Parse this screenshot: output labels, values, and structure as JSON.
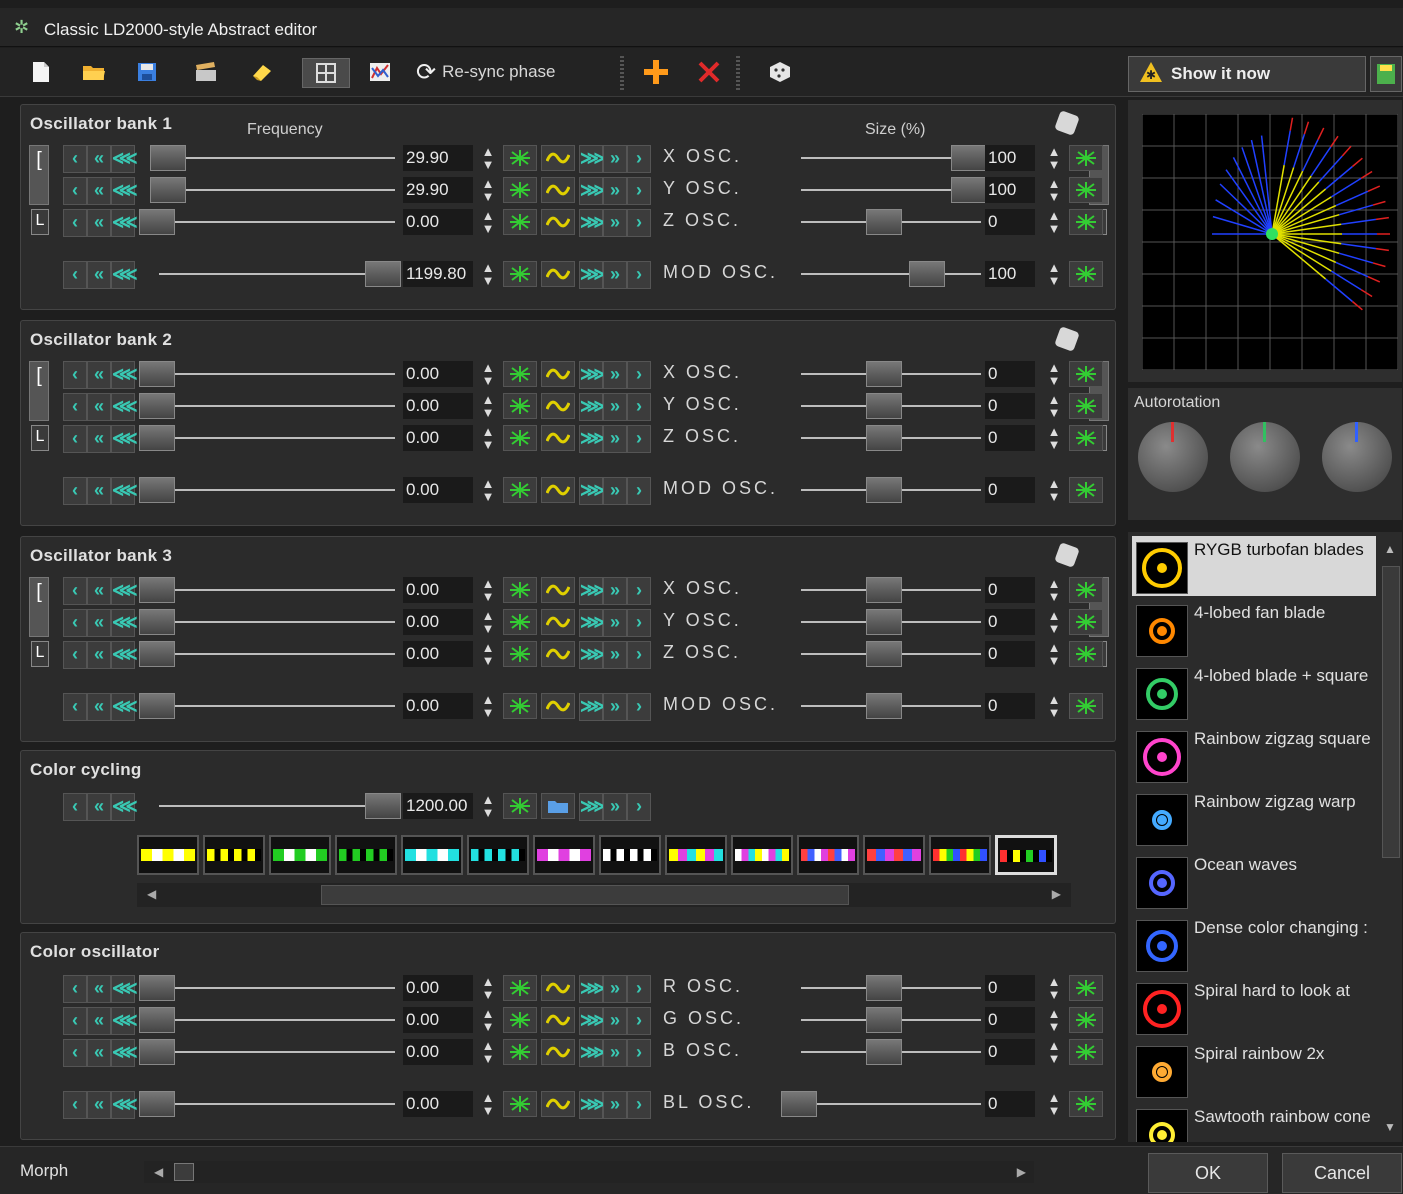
{
  "window": {
    "title": "Classic LD2000-style Abstract editor"
  },
  "toolbar": {
    "resync_label": "Re-sync phase",
    "show_now_label": "Show it now"
  },
  "headers": {
    "frequency": "Frequency",
    "size": "Size (%)"
  },
  "banks": [
    {
      "title": "Oscillator bank 1",
      "rows": [
        {
          "freq": "29.90",
          "label": "X OSC.",
          "size": "100",
          "freq_level": 0.05,
          "size_level": 1.0
        },
        {
          "freq": "29.90",
          "label": "Y OSC.",
          "size": "100",
          "freq_level": 0.05,
          "size_level": 1.0
        },
        {
          "freq": "0.00",
          "label": "Z OSC.",
          "size": "0",
          "freq_level": 0.0,
          "size_level": 0.5
        }
      ],
      "mod": {
        "freq": "1199.80",
        "label": "MOD OSC.",
        "size": "100",
        "freq_level": 1.0,
        "size_level": 0.75
      }
    },
    {
      "title": "Oscillator bank 2",
      "rows": [
        {
          "freq": "0.00",
          "label": "X OSC.",
          "size": "0",
          "freq_level": 0.0,
          "size_level": 0.5
        },
        {
          "freq": "0.00",
          "label": "Y OSC.",
          "size": "0",
          "freq_level": 0.0,
          "size_level": 0.5
        },
        {
          "freq": "0.00",
          "label": "Z OSC.",
          "size": "0",
          "freq_level": 0.0,
          "size_level": 0.5
        }
      ],
      "mod": {
        "freq": "0.00",
        "label": "MOD OSC.",
        "size": "0",
        "freq_level": 0.0,
        "size_level": 0.5
      }
    },
    {
      "title": "Oscillator bank 3",
      "rows": [
        {
          "freq": "0.00",
          "label": "X OSC.",
          "size": "0",
          "freq_level": 0.0,
          "size_level": 0.5
        },
        {
          "freq": "0.00",
          "label": "Y OSC.",
          "size": "0",
          "freq_level": 0.0,
          "size_level": 0.5
        },
        {
          "freq": "0.00",
          "label": "Z OSC.",
          "size": "0",
          "freq_level": 0.0,
          "size_level": 0.5
        }
      ],
      "mod": {
        "freq": "0.00",
        "label": "MOD OSC.",
        "size": "0",
        "freq_level": 0.0,
        "size_level": 0.5
      }
    }
  ],
  "color_cycling": {
    "title": "Color cycling",
    "value": "1200.00",
    "level": 1.0,
    "palettes": [
      {
        "colors": [
          "#ffffff",
          "#ffff00"
        ],
        "pattern": "solid"
      },
      {
        "colors": [
          "#ffff00",
          "#000000"
        ],
        "pattern": "bars"
      },
      {
        "colors": [
          "#ffffff",
          "#22cc22"
        ],
        "pattern": "solid"
      },
      {
        "colors": [
          "#22cc22",
          "#000000"
        ],
        "pattern": "bars"
      },
      {
        "colors": [
          "#ffffff",
          "#22e0e0"
        ],
        "pattern": "solid"
      },
      {
        "colors": [
          "#22e0e0",
          "#000000"
        ],
        "pattern": "bars"
      },
      {
        "colors": [
          "#ffffff",
          "#e040e0"
        ],
        "pattern": "solid"
      },
      {
        "colors": [
          "#ffffff",
          "#000000"
        ],
        "pattern": "bars"
      },
      {
        "colors": [
          "#ffff00",
          "#e040e0",
          "#22e0e0"
        ],
        "pattern": "multi"
      },
      {
        "colors": [
          "#ffffff",
          "#e040e0",
          "#22e0e0",
          "#ffff00"
        ],
        "pattern": "multi"
      },
      {
        "colors": [
          "#ff4040",
          "#4060ff",
          "#ffffff",
          "#e040e0"
        ],
        "pattern": "multi"
      },
      {
        "colors": [
          "#ff4040",
          "#4060ff",
          "#e040e0"
        ],
        "pattern": "multi"
      },
      {
        "colors": [
          "#ff3030",
          "#ffff00",
          "#22cc22",
          "#3050ff"
        ],
        "pattern": "multi"
      },
      {
        "colors": [
          "#ff3030",
          "#ffff00",
          "#22cc22",
          "#3050ff"
        ],
        "pattern": "bars4"
      }
    ]
  },
  "color_osc": {
    "title": "Color oscillator",
    "rows": [
      {
        "freq": "0.00",
        "label": "R OSC.",
        "size": "0",
        "freq_level": 0.0,
        "size_level": 0.5
      },
      {
        "freq": "0.00",
        "label": "G OSC.",
        "size": "0",
        "freq_level": 0.0,
        "size_level": 0.5
      },
      {
        "freq": "0.00",
        "label": "B OSC.",
        "size": "0",
        "freq_level": 0.0,
        "size_level": 0.5
      },
      {
        "freq": "0.00",
        "label": "BL OSC.",
        "size": "0",
        "freq_level": 0.0,
        "size_level": 0.0
      }
    ]
  },
  "autorotation": {
    "label": "Autorotation",
    "knob_colors": [
      "#e03030",
      "#30c060",
      "#3060ff"
    ]
  },
  "presets": [
    {
      "name": "RYGB turbofan blades",
      "thumb": "#ffcc00",
      "selected": true
    },
    {
      "name": "4-lobed fan blade",
      "thumb": "#ff8800",
      "selected": false
    },
    {
      "name": "4-lobed blade + square",
      "thumb": "#33cc66",
      "selected": false
    },
    {
      "name": "Rainbow zigzag square",
      "thumb": "#ff44cc",
      "selected": false
    },
    {
      "name": "Rainbow zigzag warp",
      "thumb": "#44aaff",
      "selected": false
    },
    {
      "name": "Ocean waves",
      "thumb": "#5566ff",
      "selected": false
    },
    {
      "name": "Dense color changing :",
      "thumb": "#3366ff",
      "selected": false
    },
    {
      "name": "Spiral hard to look at",
      "thumb": "#ff2222",
      "selected": false
    },
    {
      "name": "Spiral rainbow 2x",
      "thumb": "#ffaa33",
      "selected": false
    },
    {
      "name": "Sawtooth rainbow cone",
      "thumb": "#ffee33",
      "selected": false
    }
  ],
  "bottom": {
    "morph_label": "Morph",
    "ok_label": "OK",
    "cancel_label": "Cancel"
  },
  "colors": {
    "accent_teal": "#39c9b4",
    "accent_green": "#33cc33",
    "accent_yellow": "#e0d000"
  }
}
